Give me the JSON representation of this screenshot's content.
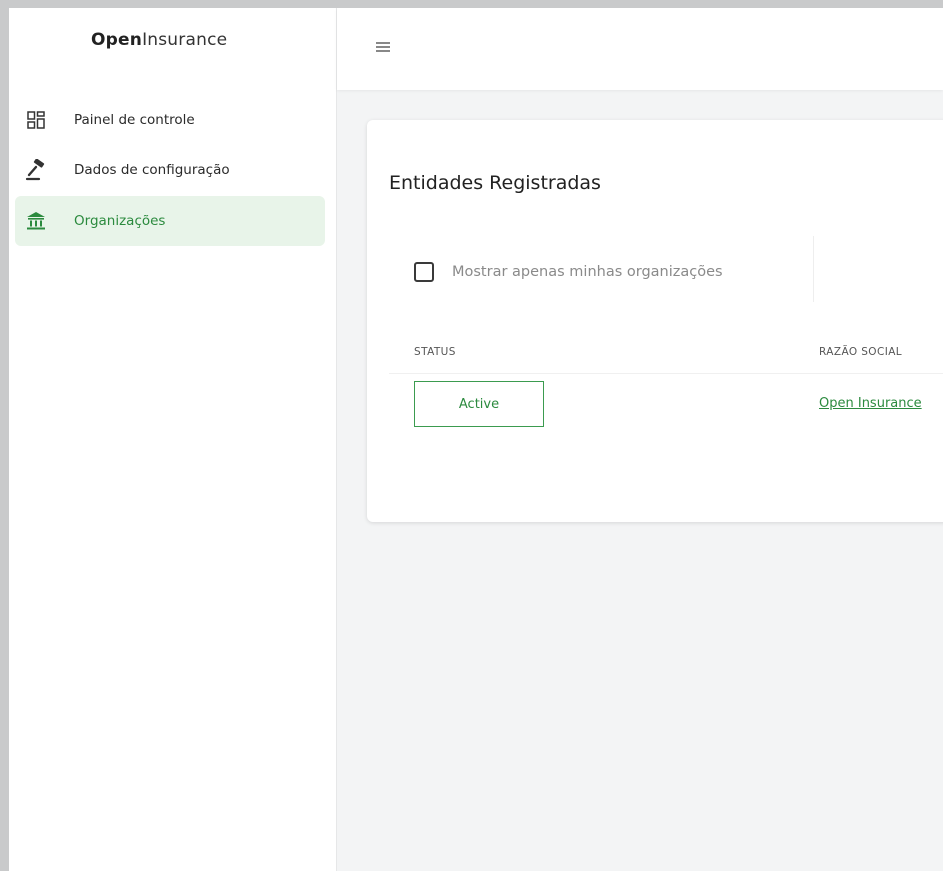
{
  "sidebar": {
    "logo": {
      "bold": "Open",
      "light": "Insurance"
    },
    "items": [
      {
        "label": "Painel de controle",
        "icon": "dashboard-icon",
        "active": false
      },
      {
        "label": "Dados de configuração",
        "icon": "gavel-icon",
        "active": false
      },
      {
        "label": "Organizações",
        "icon": "bank-icon",
        "active": true
      }
    ]
  },
  "topbar": {
    "menu_icon": "hamburger-menu-icon"
  },
  "main": {
    "title": "Entidades Registradas",
    "filter_checkbox": {
      "label": "Mostrar apenas minhas organizações",
      "checked": false
    },
    "table": {
      "columns": [
        "STATUS",
        "RAZÃO SOCIAL"
      ],
      "rows": [
        {
          "status": "Active",
          "razao_social": "Open Insurance"
        }
      ]
    }
  },
  "colors": {
    "accent_green": "#2b8a3e",
    "active_bg": "#e8f4e9",
    "page_bg": "#f3f4f5"
  }
}
